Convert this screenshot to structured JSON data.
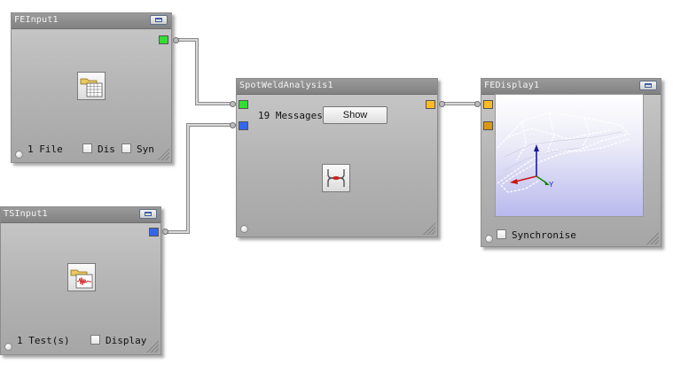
{
  "nodes": {
    "fe_input": {
      "title": "FEInput1",
      "status": "1 File",
      "check1_label": "Dis",
      "check2_label": "Sync"
    },
    "ts_input": {
      "title": "TSInput1",
      "status": "1 Test(s)",
      "check_label": "Display"
    },
    "spotweld": {
      "title": "SpotWeldAnalysis1",
      "messages": "19 Messages",
      "show_label": "Show"
    },
    "fe_display": {
      "title": "FEDisplay1",
      "check_label": "Synchronise",
      "axis_label_y": "Y"
    }
  },
  "colors": {
    "port_green": "#33dd33",
    "port_blue": "#3366ee",
    "port_orange": "#ffbb22",
    "port_darkorange": "#d9980f"
  },
  "icons": {
    "fe_input": "folder-grid-icon",
    "ts_input": "folder-signal-icon",
    "spotweld": "analysis-icon",
    "window": "restore-window-icon"
  }
}
